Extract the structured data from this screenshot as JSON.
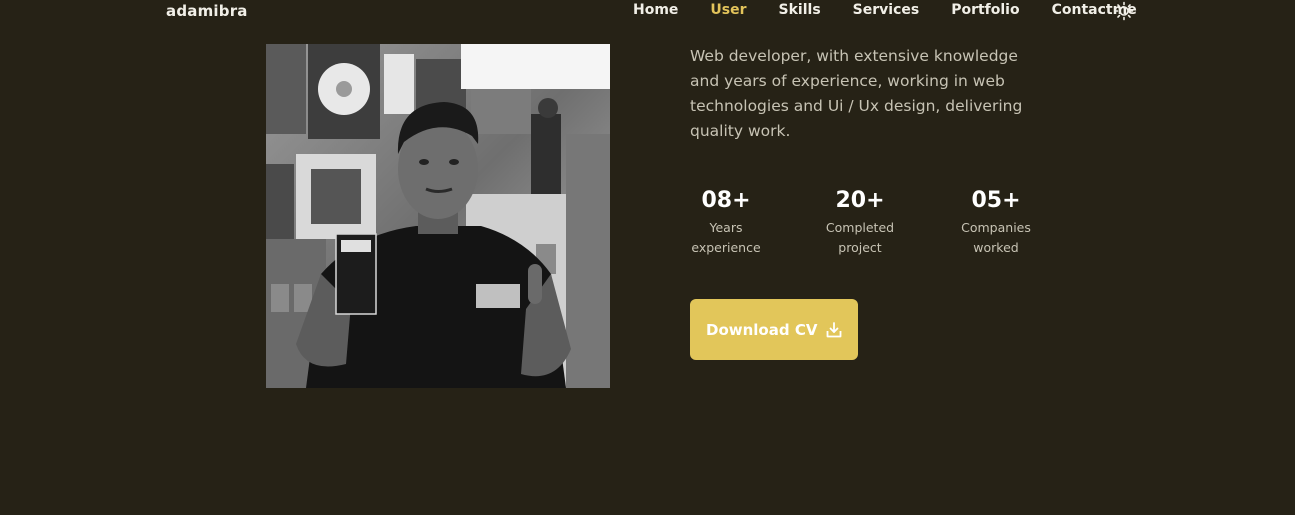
{
  "header": {
    "logo": "adamibra",
    "nav": [
      {
        "label": "Home",
        "active": false
      },
      {
        "label": "User",
        "active": true
      },
      {
        "label": "Skills",
        "active": false
      },
      {
        "label": "Services",
        "active": false
      },
      {
        "label": "Portfolio",
        "active": false
      },
      {
        "label": "Contactme",
        "active": false
      }
    ],
    "theme_icon": "sun-icon"
  },
  "about": {
    "photo_icon": "profile-photo",
    "bio": "Web developer, with extensive knowledge and years of experience, working in web technologies and Ui / Ux design, delivering quality work.",
    "stats": [
      {
        "value": "08+",
        "line1": "Years",
        "line2": "experience"
      },
      {
        "value": "20+",
        "line1": "Completed",
        "line2": "project"
      },
      {
        "value": "05+",
        "line1": "Companies",
        "line2": "worked"
      }
    ],
    "download_button": {
      "label": "Download CV",
      "icon": "download-icon"
    }
  },
  "colors": {
    "background": "#262216",
    "accent": "#e3c45b",
    "button": "#e2c65a",
    "text_muted": "#c7c3b4"
  }
}
